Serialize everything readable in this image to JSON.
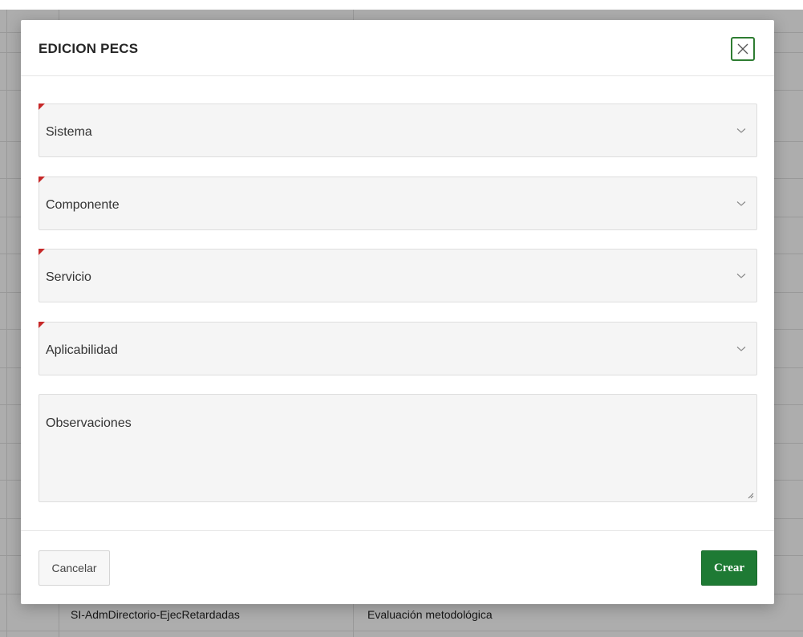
{
  "modal": {
    "title": "EDICION PECS",
    "fields": [
      {
        "label": "Sistema",
        "required": true,
        "type": "select"
      },
      {
        "label": "Componente",
        "required": true,
        "type": "select"
      },
      {
        "label": "Servicio",
        "required": true,
        "type": "select"
      },
      {
        "label": "Aplicabilidad",
        "required": true,
        "type": "select"
      }
    ],
    "observations": {
      "label": "Observaciones"
    },
    "footer": {
      "cancel_label": "Cancelar",
      "create_label": "Crear"
    }
  },
  "background_table": {
    "visible_row": [
      "SI-AdmDirectorio-EjecRetardadas",
      "Evaluación metodológica"
    ]
  },
  "colors": {
    "primary_green": "#1e7a34",
    "required_marker": "#c62828",
    "close_border": "#2e7d32"
  },
  "icons": {
    "close": "close-icon",
    "chevron": "chevron-down-icon",
    "resize": "resize-handle-icon"
  }
}
